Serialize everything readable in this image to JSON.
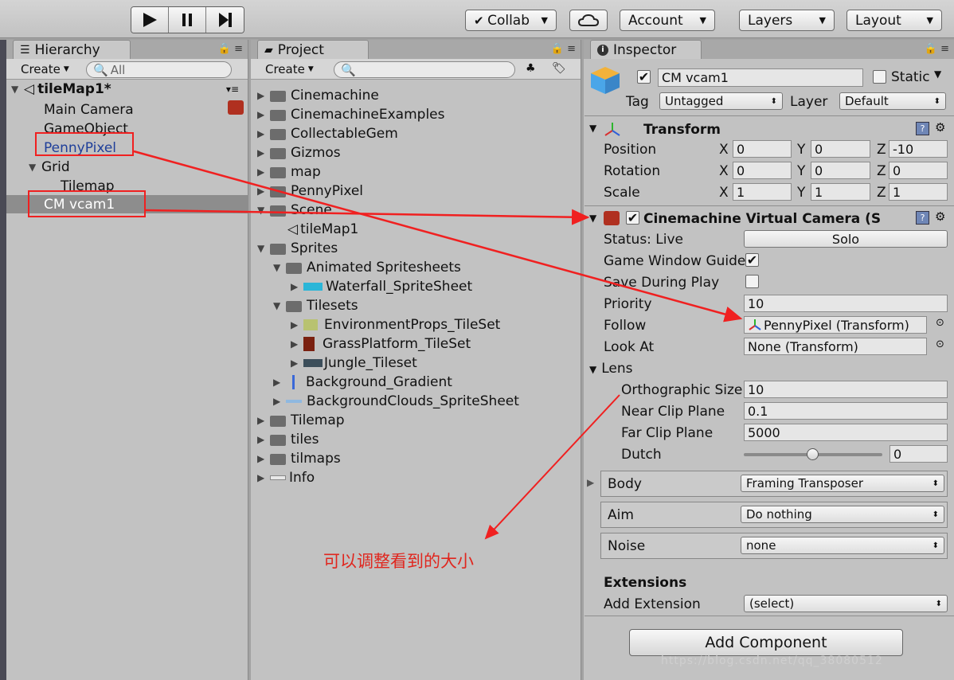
{
  "toolbar": {
    "collab": "Collab",
    "account": "Account",
    "layers": "Layers",
    "layout": "Layout"
  },
  "hierarchy": {
    "tab": "Hierarchy",
    "create": "Create",
    "search_placeholder": "All",
    "scene": "tileMap1*",
    "items": [
      "Main Camera",
      "GameObject",
      "PennyPixel",
      "Grid",
      "Tilemap",
      "CM vcam1"
    ]
  },
  "project": {
    "tab": "Project",
    "create": "Create",
    "items": [
      "Cinemachine",
      "CinemachineExamples",
      "CollectableGem",
      "Gizmos",
      "map",
      "PennyPixel",
      "Scene",
      "tileMap1",
      "Sprites",
      "Animated Spritesheets",
      "Waterfall_SpriteSheet",
      "Tilesets",
      "EnvironmentProps_TileSet",
      "GrassPlatform_TileSet",
      "Jungle_Tileset",
      "Background_Gradient",
      "BackgroundClouds_SpriteSheet",
      "Tilemap",
      "tiles",
      "tilmaps",
      "Info"
    ]
  },
  "inspector": {
    "tab": "Inspector",
    "object_name": "CM vcam1",
    "static_label": "Static",
    "tag_label": "Tag",
    "tag_value": "Untagged",
    "layer_label": "Layer",
    "layer_value": "Default",
    "transform": {
      "title": "Transform",
      "position_label": "Position",
      "rotation_label": "Rotation",
      "scale_label": "Scale",
      "axis_x": "X",
      "axis_y": "Y",
      "axis_z": "Z",
      "position": [
        "0",
        "0",
        "-10"
      ],
      "rotation": [
        "0",
        "0",
        "0"
      ],
      "scale": [
        "1",
        "1",
        "1"
      ]
    },
    "vcam": {
      "title": "Cinemachine Virtual Camera (S",
      "status_label": "Status: Live",
      "solo": "Solo",
      "game_window_guides": "Game Window Guide",
      "save_during_play": "Save During Play",
      "priority_label": "Priority",
      "priority": "10",
      "follow_label": "Follow",
      "follow": "PennyPixel (Transform)",
      "look_at_label": "Look At",
      "look_at": "None (Transform)",
      "lens_label": "Lens",
      "ortho_label": "Orthographic Size",
      "ortho": "10",
      "near_label": "Near Clip Plane",
      "near": "0.1",
      "far_label": "Far Clip Plane",
      "far": "5000",
      "dutch_label": "Dutch",
      "dutch": "0",
      "dutch_level": 0.5,
      "body_label": "Body",
      "body": "Framing Transposer",
      "aim_label": "Aim",
      "aim": "Do nothing",
      "noise_label": "Noise",
      "noise": "none"
    },
    "extensions_label": "Extensions",
    "add_extension_label": "Add Extension",
    "add_extension": "(select)",
    "add_component": "Add Component"
  },
  "annotation": "可以调整看到的大小",
  "watermark": "https://blog.csdn.net/qq_38080512"
}
